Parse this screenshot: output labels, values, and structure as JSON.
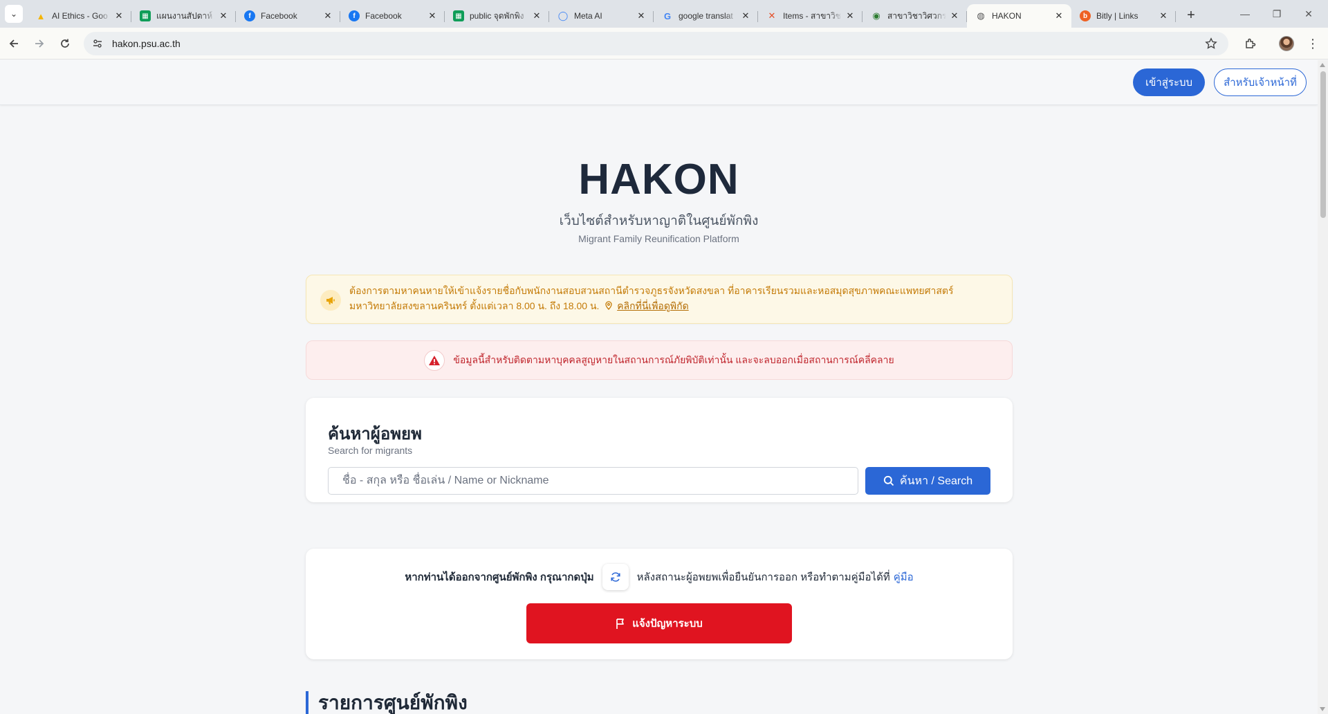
{
  "browser": {
    "tabs": [
      {
        "title": "AI Ethics - Goo",
        "icon": "google-drive-icon",
        "color": "#f4b400"
      },
      {
        "title": "แผนงานสัปดาห์ A",
        "icon": "google-sheets-icon",
        "color": "#0f9d58"
      },
      {
        "title": "Facebook",
        "icon": "facebook-icon",
        "color": "#1877f2"
      },
      {
        "title": "Facebook",
        "icon": "facebook-icon",
        "color": "#1877f2"
      },
      {
        "title": "public จุดพักพิง",
        "icon": "google-sheets-icon",
        "color": "#0f9d58"
      },
      {
        "title": "Meta AI",
        "icon": "meta-ai-icon",
        "color": "#3b82f6"
      },
      {
        "title": "google translat",
        "icon": "google-icon",
        "color": "#4285f4"
      },
      {
        "title": "Items - สาขาวิช",
        "icon": "items-icon",
        "color": "#e44d26"
      },
      {
        "title": "สาขาวิชาวิศวกรร",
        "icon": "university-icon",
        "color": "#2e7d32"
      },
      {
        "title": "HAKON",
        "icon": "globe-icon",
        "color": "#555555"
      },
      {
        "title": "Bitly | Links",
        "icon": "bitly-icon",
        "color": "#ee6123"
      }
    ],
    "active_tab_index": 9,
    "url": "hakon.psu.ac.th"
  },
  "header": {
    "login_label": "เข้าสู่ระบบ",
    "staff_label": "สำหรับเจ้าหน้าที่"
  },
  "hero": {
    "title": "HAKON",
    "subtitle_th": "เว็บไซต์สำหรับหาญาติในศูนย์พักพิง",
    "subtitle_en": "Migrant Family Reunification Platform"
  },
  "notice": {
    "text": "ต้องการตามหาคนหายให้เข้าแจ้งรายชื่อกับพนักงานสอบสวนสถานีตำรวจภูธรจังหวัดสงขลา ที่อาคารเรียนรวมและหอสมุดสุขภาพคณะแพทยศาสตร์ มหาวิทยาลัยสงขลานครินทร์ ตั้งแต่เวลา 8.00 น. ถึง 18.00 น.",
    "link_text": "คลิกที่นี่เพื่อดูพิกัด"
  },
  "warning": {
    "text": "ข้อมูลนี้สำหรับติดตามหาบุคคลสูญหายในสถานการณ์ภัยพิบัติเท่านั้น และจะลบออกเมื่อสถานการณ์คลี่คลาย"
  },
  "search": {
    "heading": "ค้นหาผู้อพยพ",
    "subheading": "Search for migrants",
    "placeholder": "ชื่อ - สกุล หรือ ชื่อเล่น / Name or Nickname",
    "button_label": "ค้นหา / Search"
  },
  "exit": {
    "text_before": "หากท่านได้ออกจากศูนย์พักพิง กรุณากดปุ่ม",
    "text_after": "หลังสถานะผู้อพยพเพื่อยืนยันการออก หรือทำตามคู่มือได้ที่",
    "manual_link": "คู่มือ",
    "report_label": "แจ้งปัญหาระบบ"
  },
  "shelters": {
    "heading": "รายการศูนย์พักพิง"
  },
  "colors": {
    "primary": "#2b67d6",
    "danger": "#e01420",
    "notice_text": "#c47a06",
    "warning_text": "#c0262d"
  }
}
